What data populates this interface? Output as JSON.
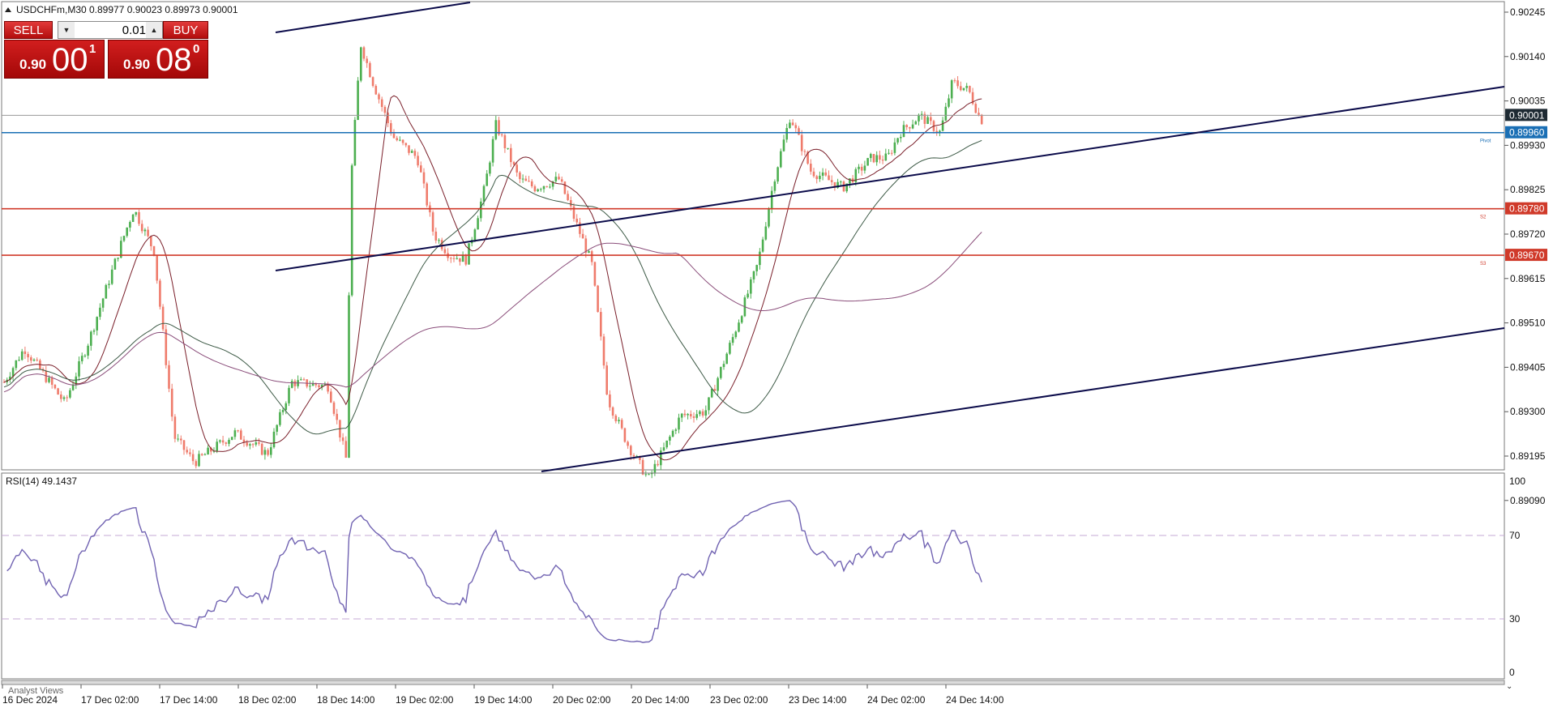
{
  "header": {
    "symbol": "USDCHFm,M30",
    "quotes": "0.89977 0.90023 0.89973 0.90001"
  },
  "trade_panel": {
    "sell_label": "SELL",
    "buy_label": "BUY",
    "lot_value": "0.01",
    "sell_price": {
      "prefix": "0.90",
      "big": "00",
      "sup": "1"
    },
    "buy_price": {
      "prefix": "0.90",
      "big": "08",
      "sup": "0"
    }
  },
  "price_axis": {
    "ticks": [
      "0.90245",
      "0.90140",
      "0.90035",
      "0.89930",
      "0.89825",
      "0.89720",
      "0.89615",
      "0.89510",
      "0.89405",
      "0.89300",
      "0.89195",
      "0.89090"
    ],
    "current_price": "0.90001",
    "levels": [
      {
        "id": "pivot",
        "price": "0.89960",
        "label": "Pivot",
        "color": "#1a6fb5"
      },
      {
        "id": "s2",
        "price": "0.89780",
        "label": "S2",
        "color": "#d03a2a"
      },
      {
        "id": "s3",
        "price": "0.89670",
        "label": "S3",
        "color": "#d03a2a"
      }
    ]
  },
  "rsi": {
    "title": "RSI(14) 49.1437",
    "ticks": [
      "100",
      "70",
      "30",
      "0"
    ]
  },
  "time_axis": {
    "labels": [
      "16 Dec 2024",
      "17 Dec 02:00",
      "17 Dec 14:00",
      "18 Dec 02:00",
      "18 Dec 14:00",
      "19 Dec 02:00",
      "19 Dec 14:00",
      "20 Dec 02:00",
      "20 Dec 14:00",
      "23 Dec 02:00",
      "23 Dec 14:00",
      "24 Dec 02:00",
      "24 Dec 14:00"
    ]
  },
  "footer": {
    "analyst_views": "Analyst Views"
  },
  "colors": {
    "bull": "#4caf50",
    "bear": "#ef7b6b",
    "pivot": "#1a6fb5",
    "support": "#d03a2a",
    "trendline": "#0b0b4a",
    "rsi": "#7163b2"
  },
  "chart_data": {
    "type": "candlestick",
    "title": "USDCHFm,M30",
    "timeframe": "M30",
    "ylim": [
      0.8905,
      0.903
    ],
    "overlay_lines": [
      {
        "price": 0.90001,
        "style": "current"
      },
      {
        "price": 0.8996,
        "style": "pivot"
      },
      {
        "price": 0.8978,
        "style": "S2"
      },
      {
        "price": 0.8967,
        "style": "S3"
      }
    ],
    "close_path": [
      {
        "x": "16 Dec 2024",
        "close": 0.8937
      },
      {
        "x": "17 Dec 02:00",
        "close": 0.8962
      },
      {
        "x": "17 Dec 14:00",
        "close": 0.8923
      },
      {
        "x": "18 Dec 02:00",
        "close": 0.893
      },
      {
        "x": "18 Dec 14:00",
        "close": 0.8918
      },
      {
        "x": "18 Dec 15:00",
        "close": 0.9013
      },
      {
        "x": "19 Dec 02:00",
        "close": 0.8995
      },
      {
        "x": "19 Dec 14:00",
        "close": 0.8966
      },
      {
        "x": "19 Dec 17:00",
        "close": 0.8987
      },
      {
        "x": "20 Dec 02:00",
        "close": 0.8978
      },
      {
        "x": "20 Dec 14:00",
        "close": 0.892
      },
      {
        "x": "23 Dec 02:00",
        "close": 0.894
      },
      {
        "x": "23 Dec 12:00",
        "close": 0.8997
      },
      {
        "x": "23 Dec 14:00",
        "close": 0.8985
      },
      {
        "x": "24 Dec 02:00",
        "close": 0.8998
      },
      {
        "x": "24 Dec 08:00",
        "close": 0.9008
      },
      {
        "x": "24 Dec 16:00",
        "close": 0.9
      }
    ],
    "rsi": {
      "period": 14,
      "last": 49.1437,
      "levels": [
        70,
        30
      ],
      "ylim": [
        0,
        100
      ]
    }
  }
}
